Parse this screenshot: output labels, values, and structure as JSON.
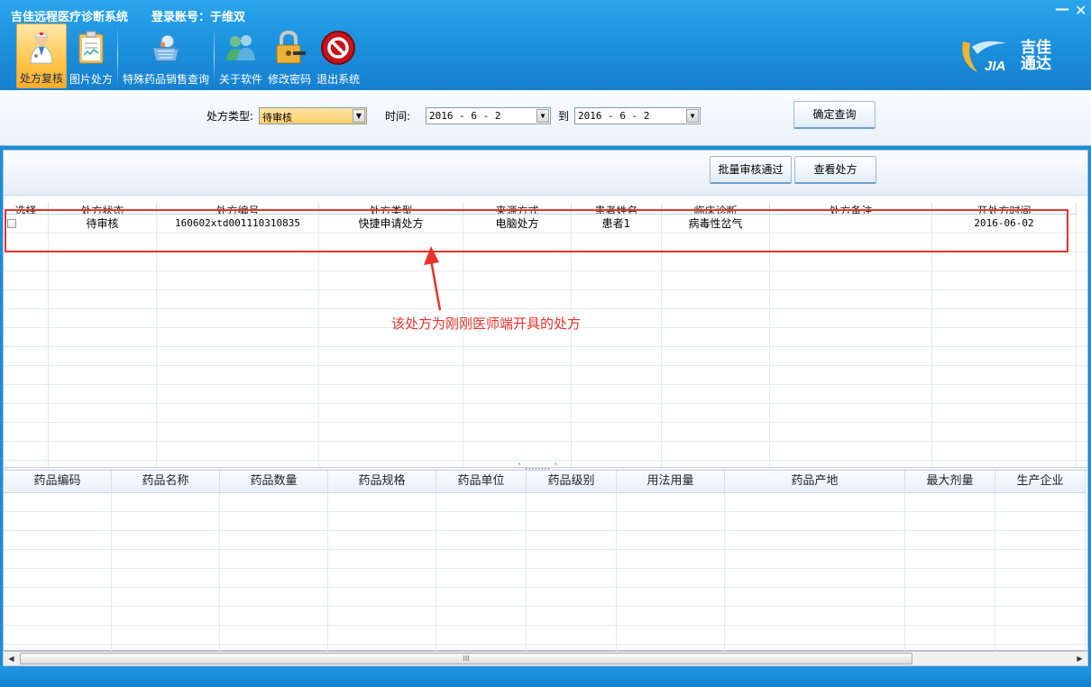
{
  "window": {
    "title": "吉佳远程医疗诊断系统",
    "login_info": "登录账号：于维双",
    "minimize": "—",
    "close": "✕"
  },
  "toolbar": {
    "items": [
      {
        "label": "处方复核",
        "icon": "doctor-icon",
        "active": true
      },
      {
        "label": "图片处方",
        "icon": "clipboard-icon"
      },
      {
        "label": "特殊药品销售查询",
        "icon": "magnifier-cart-icon"
      },
      {
        "label": "关于软件",
        "icon": "users-icon"
      },
      {
        "label": "修改密码",
        "icon": "padlock-icon"
      },
      {
        "label": "退出系统",
        "icon": "stop-icon"
      }
    ]
  },
  "brand": {
    "name_line1": "吉佳",
    "name_line2": "通达",
    "logo_text": "JIA"
  },
  "filter": {
    "type_label": "处方类型:",
    "type_value": "待审核",
    "time_label": "时间:",
    "date_from": "2016 - 6 - 2",
    "to_label": "到",
    "date_to": "2016 - 6 - 2",
    "query_button": "确定查询"
  },
  "actions": {
    "batch_approve": "批量审核通过",
    "view_prescription": "查看处方"
  },
  "prescription_table": {
    "columns": [
      "选择",
      "处方状态",
      "处方编号",
      "处方类型",
      "来源方式",
      "患者姓名",
      "临床诊断",
      "处方备注",
      "开处方时间"
    ],
    "rows": [
      {
        "status": "待审核",
        "number": "160602xtd001110310835",
        "type": "快捷申请处方",
        "source": "电脑处方",
        "patient": "患者1",
        "diagnosis": "病毒性岔气",
        "note": "",
        "time": "2016-06-02"
      }
    ]
  },
  "drug_table": {
    "columns": [
      "药品编码",
      "药品名称",
      "药品数量",
      "药品规格",
      "药品单位",
      "药品级别",
      "用法用量",
      "药品产地",
      "最大剂量",
      "生产企业"
    ]
  },
  "annotation": {
    "text": "该处方为刚刚医师端开具的处方",
    "color": "#e8332c"
  },
  "scrollbar": {
    "left_arrow": "◀",
    "right_arrow": "▶",
    "grip": "III"
  }
}
